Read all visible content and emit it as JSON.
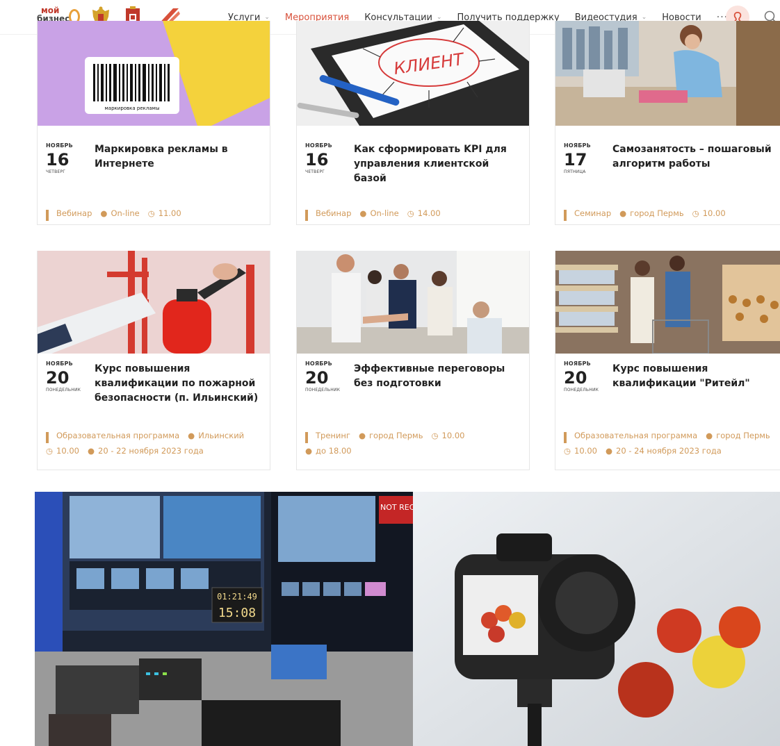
{
  "header": {
    "logo_line1": "мой",
    "logo_line2": "бизнес",
    "nav": [
      {
        "label": "Услуги",
        "dropdown": true,
        "active": false
      },
      {
        "label": "Мероприятия",
        "dropdown": false,
        "active": true
      },
      {
        "label": "Консультации",
        "dropdown": true,
        "active": false
      },
      {
        "label": "Получить поддержку",
        "dropdown": false,
        "active": false
      },
      {
        "label": "Видеостудия",
        "dropdown": true,
        "active": false
      },
      {
        "label": "Новости",
        "dropdown": false,
        "active": false
      }
    ],
    "more": "···"
  },
  "colors": {
    "accent": "#d8513b",
    "meta": "#d19a5a",
    "card_border": "#e6e6e6"
  },
  "events": [
    {
      "month": "НОЯБРЬ",
      "day": "16",
      "weekday": "ЧЕТВЕРГ",
      "title": "Маркировка рекламы в Интернете",
      "type": "Вебинар",
      "place": "On-line",
      "time": "11.00",
      "extra": "",
      "image": "barcode-illustration"
    },
    {
      "month": "НОЯБРЬ",
      "day": "16",
      "weekday": "ЧЕТВЕРГ",
      "title": "Как сформировать KPI для управления клиентской базой",
      "type": "Вебинар",
      "place": "On-line",
      "time": "14.00",
      "extra": "",
      "image": "tablet-client"
    },
    {
      "month": "НОЯБРЬ",
      "day": "17",
      "weekday": "ПЯТНИЦА",
      "title": "Самозанятость – пошаговый алгоритм работы",
      "type": "Семинар",
      "place": "город Пермь",
      "time": "10.00",
      "extra": "",
      "image": "tailor-workshop"
    },
    {
      "month": "НОЯБРЬ",
      "day": "20",
      "weekday": "ПОНЕДЕЛЬНИК",
      "title": "Курс повышения квалификации по пожарной безопасности (п. Ильинский)",
      "type": "Образовательная программа",
      "place": "Ильинский",
      "time": "10.00",
      "extra": "20 - 22 ноября 2023 года",
      "image": "fire-extinguisher"
    },
    {
      "month": "НОЯБРЬ",
      "day": "20",
      "weekday": "ПОНЕДЕЛЬНИК",
      "title": "Эффективные переговоры без подготовки",
      "type": "Тренинг",
      "place": "город Пермь",
      "time": "10.00",
      "extra": "до 18.00",
      "image": "business-handshake"
    },
    {
      "month": "НОЯБРЬ",
      "day": "20",
      "weekday": "ПОНЕДЕЛЬНИК",
      "title": "Курс повышения квалификации \"Ритейл\"",
      "type": "Образовательная программа",
      "place": "город Пермь",
      "time": "10.00",
      "extra": "20 - 24 ноября 2023 года",
      "image": "supermarket"
    }
  ],
  "studio": {
    "clock_top": "01:21:49",
    "clock_bottom": "15:08",
    "monitor_text": "NOT REC"
  },
  "tablet_word": "КЛИЕНТ",
  "barcode_caption": "маркировка рекламы"
}
